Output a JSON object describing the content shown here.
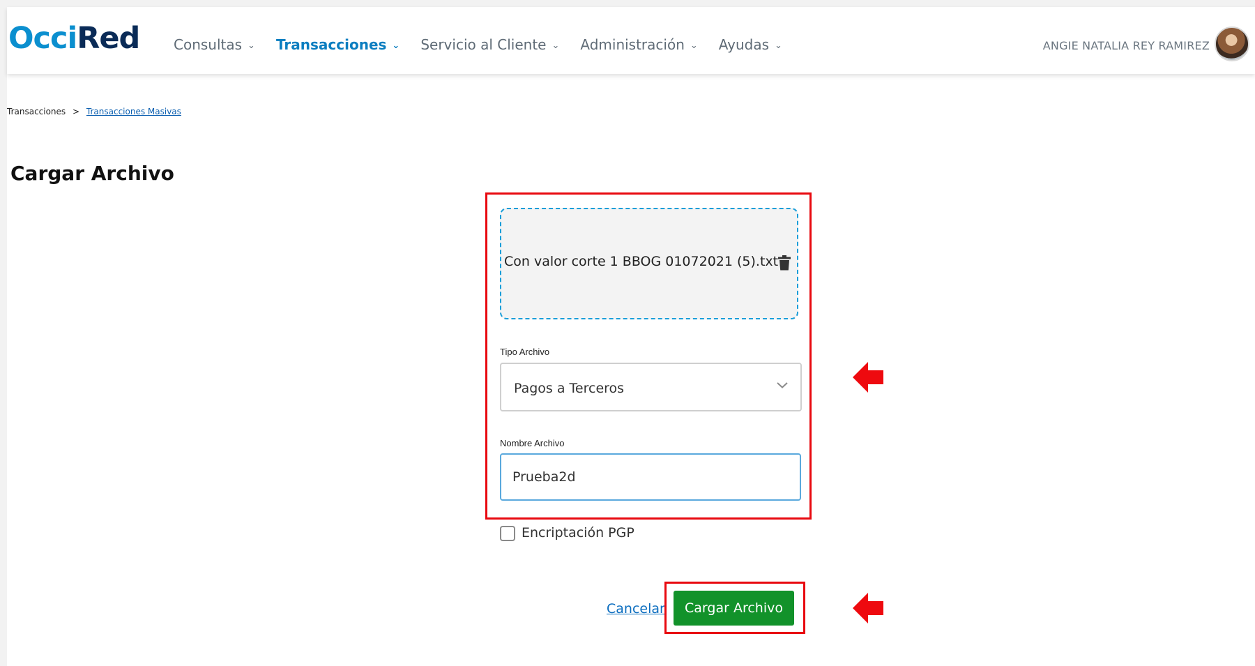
{
  "header": {
    "logo": {
      "part1": "Occi",
      "part2": "Red"
    },
    "nav": [
      {
        "label": "Consultas",
        "active": false
      },
      {
        "label": "Transacciones",
        "active": true
      },
      {
        "label": "Servicio al Cliente",
        "active": false
      },
      {
        "label": "Administración",
        "active": false
      },
      {
        "label": "Ayudas",
        "active": false
      }
    ],
    "user_name": "ANGIE NATALIA REY RAMIREZ",
    "chevron_glyph": "⌄"
  },
  "breadcrumb": {
    "root": "Transacciones",
    "separator": ">",
    "current": "Transacciones Masivas"
  },
  "page_title": "Cargar Archivo",
  "upload": {
    "file_name": "Con valor corte 1 BBOG 01072021 (5).txt",
    "delete_icon": "trash-icon"
  },
  "form": {
    "tipo_label": "Tipo Archivo",
    "tipo_value": "Pagos a Terceros",
    "nombre_label": "Nombre Archivo",
    "nombre_value": "Prueba2d",
    "pgp_label": "Encriptación PGP",
    "pgp_checked": false
  },
  "actions": {
    "cancel_label": "Cancelar",
    "submit_label": "Cargar Archivo"
  },
  "colors": {
    "brand_light": "#0b8fcf",
    "brand_dark": "#0a2b57",
    "submit_green": "#12922a",
    "highlight_red": "#e8090f",
    "dropzone_border": "#1a9ed9"
  }
}
